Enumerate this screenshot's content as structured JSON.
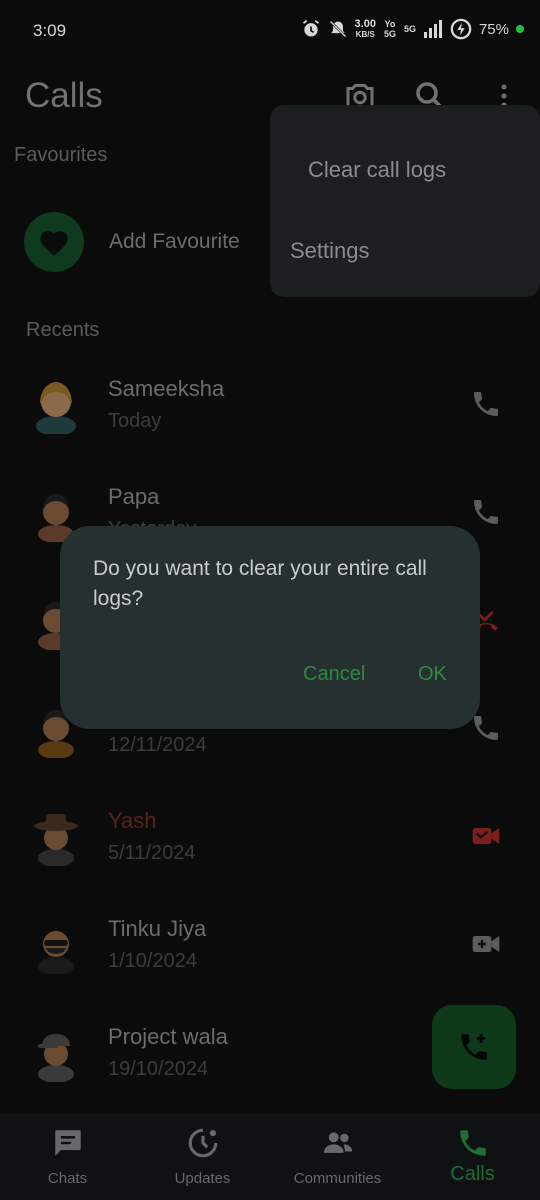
{
  "status_bar": {
    "time": "3:09",
    "net_speed": "3.00",
    "net_unit": "KB/S",
    "signal_label": "Yo 5G",
    "network_label": "5G",
    "battery": "75%",
    "dot_color": "#1cc33a"
  },
  "header": {
    "title": "Calls",
    "icons": [
      "camera-icon",
      "search-icon",
      "more-vertical-icon"
    ]
  },
  "favourites": {
    "section_label": "Favourites",
    "add_label": "Add Favourite"
  },
  "recents": {
    "section_label": "Recents",
    "calls": [
      {
        "name": "Sameeksha",
        "date": "Today",
        "type": "voice",
        "missed": false
      },
      {
        "name": "Papa",
        "date": "Yesterday",
        "type": "voice",
        "missed": false
      },
      {
        "name": "",
        "date": "",
        "type": "missed-voice",
        "missed": true
      },
      {
        "name": "",
        "date": "12/11/2024",
        "type": "voice",
        "missed": false
      },
      {
        "name": "Yash",
        "date": "5/11/2024",
        "type": "missed-video",
        "missed": true
      },
      {
        "name": "Tinku Jiya",
        "date": "1/10/2024",
        "type": "video",
        "missed": false
      },
      {
        "name": "Project wala",
        "date": "19/10/2024",
        "type": "voice",
        "missed": false
      }
    ]
  },
  "bottom_nav": {
    "items": [
      {
        "label": "Chats",
        "icon": "chat-icon"
      },
      {
        "label": "Updates",
        "icon": "updates-icon"
      },
      {
        "label": "Communities",
        "icon": "communities-icon"
      },
      {
        "label": "Calls",
        "icon": "calls-icon",
        "active": true
      }
    ]
  },
  "overflow_menu": {
    "items": [
      "Clear call logs",
      "Settings"
    ]
  },
  "dialog": {
    "message": "Do you want to clear your entire call logs?",
    "cancel_label": "Cancel",
    "ok_label": "OK"
  },
  "colors": {
    "accent": "#2b8a3f",
    "missed": "#7a1f1a",
    "dialog_bg": "#273031",
    "menu_bg": "#1b1f20"
  }
}
